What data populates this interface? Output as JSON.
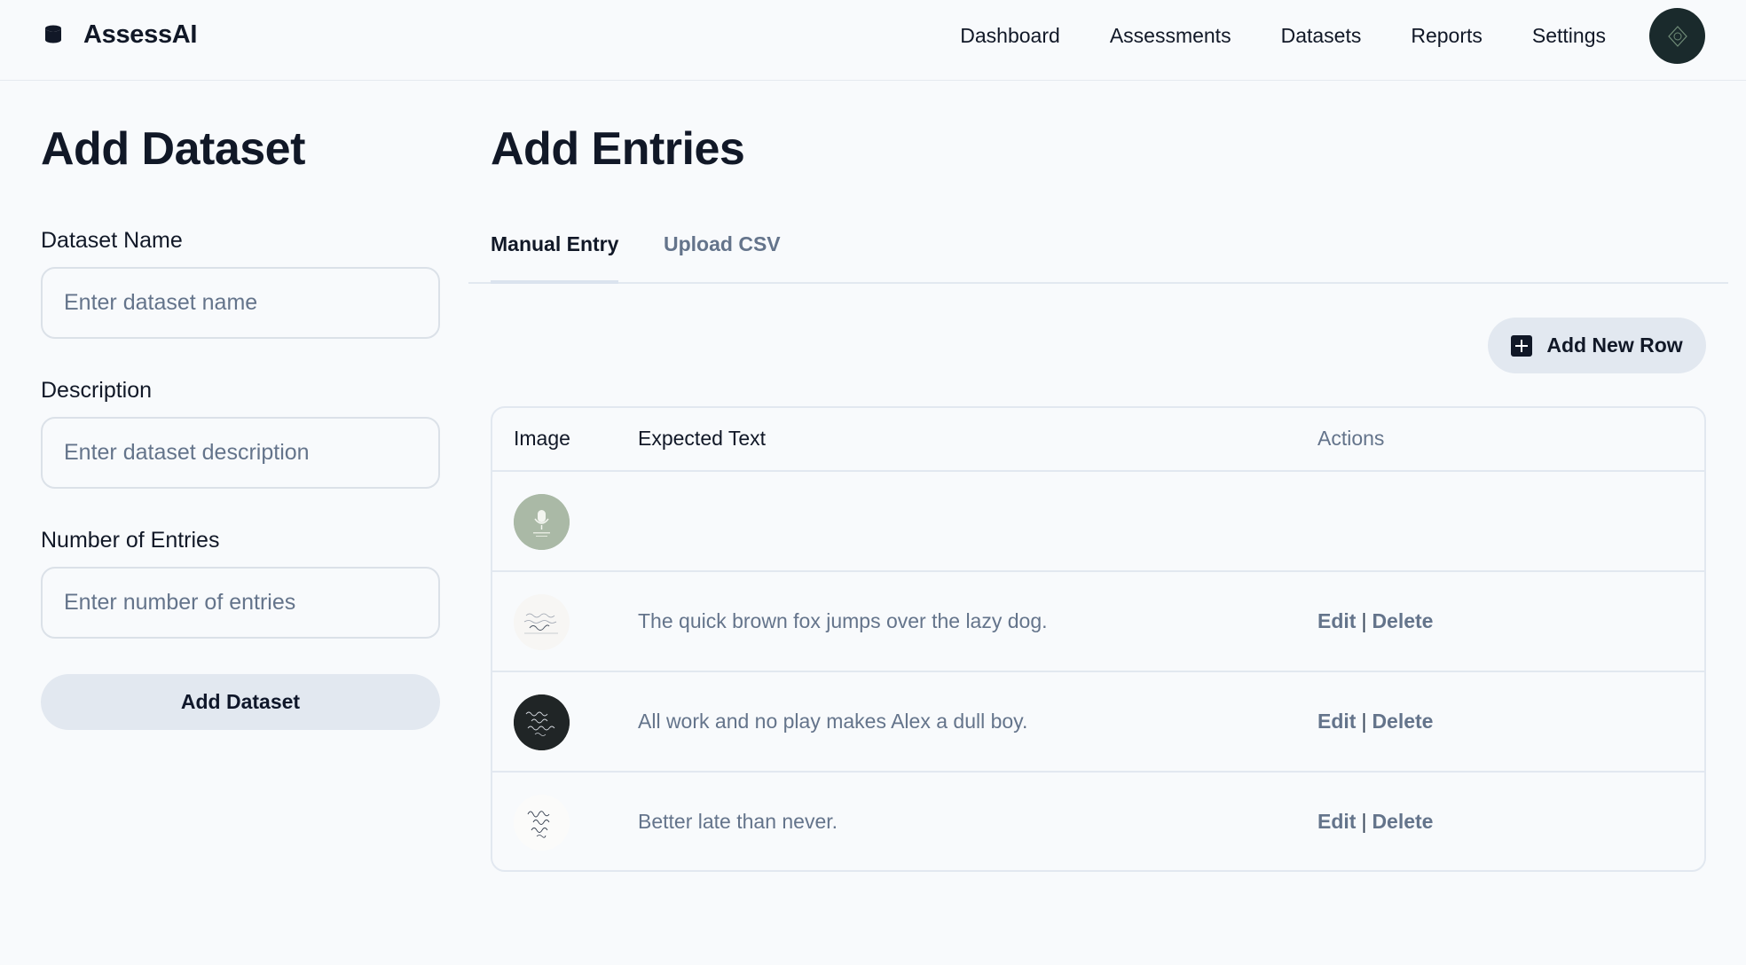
{
  "app": {
    "name": "AssessAI",
    "icon": "database-icon"
  },
  "nav": {
    "items": [
      "Dashboard",
      "Assessments",
      "Datasets",
      "Reports",
      "Settings"
    ]
  },
  "left": {
    "title": "Add Dataset",
    "fields": {
      "name": {
        "label": "Dataset Name",
        "placeholder": "Enter dataset name",
        "value": ""
      },
      "description": {
        "label": "Description",
        "placeholder": "Enter dataset description",
        "value": ""
      },
      "entries": {
        "label": "Number of Entries",
        "placeholder": "Enter number of entries",
        "value": ""
      }
    },
    "submit_label": "Add Dataset"
  },
  "right": {
    "title": "Add Entries",
    "tabs": [
      {
        "label": "Manual Entry",
        "active": true
      },
      {
        "label": "Upload CSV",
        "active": false
      }
    ],
    "add_row_label": "Add New Row",
    "table": {
      "headers": [
        "Image",
        "Expected Text",
        "Actions"
      ],
      "rows": [
        {
          "image": "microphone-thumbnail",
          "text": "",
          "actions": ""
        },
        {
          "image": "handwriting-sample-light",
          "text": "The quick brown fox jumps over the lazy dog.",
          "edit": "Edit",
          "delete": "Delete"
        },
        {
          "image": "handwriting-sample-dark",
          "text": "All work and no play makes Alex a dull boy.",
          "edit": "Edit",
          "delete": "Delete"
        },
        {
          "image": "handwriting-sample-cursive",
          "text": "Better late than never.",
          "edit": "Edit",
          "delete": "Delete"
        }
      ]
    }
  },
  "colors": {
    "background": "#f8fafc",
    "button_bg": "#e2e8f0",
    "muted_text": "#64748b",
    "text": "#111827"
  }
}
